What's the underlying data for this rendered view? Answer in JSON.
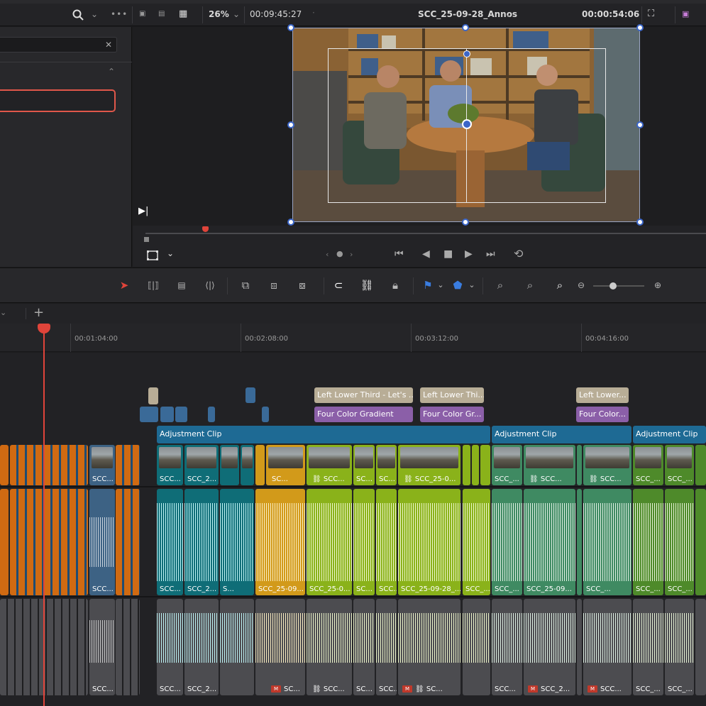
{
  "viewer": {
    "zoom": "26%",
    "source_timecode": "00:09:45:27",
    "timeline_name": "SCC_25-09-28_Annos",
    "record_timecode": "00:00:54:06"
  },
  "ruler": {
    "timecodes": [
      "00:01:04:00",
      "00:02:08:00",
      "00:03:12:00",
      "00:04:16:00"
    ]
  },
  "titles": {
    "lower_third_1": "Left Lower Third - Let's ...",
    "lower_third_2": "Left Lower Thi...",
    "lower_third_3": "Left Lower...",
    "gradient_1": "Four Color Gradient",
    "gradient_2": "Four Color Gr...",
    "gradient_3": "Four Color..."
  },
  "adjustment": {
    "label_1": "Adjustment Clip",
    "label_2": "Adjustment Clip",
    "label_3": "Adjustment Clip"
  },
  "video_clips": [
    "SCC...",
    "SCC_2...",
    "SC...",
    "SC...",
    "SC...",
    "SC...",
    "SCC_25-0...",
    "SCC_...",
    "SCC_...",
    "SCC_...",
    "SCC_...",
    "SCC_..."
  ],
  "audio1_clips": [
    "SCC...",
    "SCC...",
    "SCC_2...",
    "S...",
    "SCC_25-09...",
    "SCC_25-0...",
    "SC...",
    "SCC...",
    "SCC_25-09-28_...",
    "SCC_...",
    "SCC_...",
    "SCC_25-09...",
    "SCC_...",
    "SCC_...",
    "SCC_..."
  ],
  "audio2_clips": [
    "SCC...",
    "SCC_2...",
    "SC...",
    "SCC...",
    "SC...",
    "SCC...",
    "SC...",
    "SCC...",
    "SCC...",
    "SCC_...",
    "SCC_2...",
    "SCC...",
    "SCC_...",
    "SCC_..."
  ],
  "colors": {
    "accent_red": "#e0443a",
    "adjustment": "#1e6a94",
    "teal": "#0f6d77",
    "green": "#8ab21a",
    "orange": "#d06a12",
    "purple": "#8b5fa8",
    "tan": "#b8ad96"
  }
}
